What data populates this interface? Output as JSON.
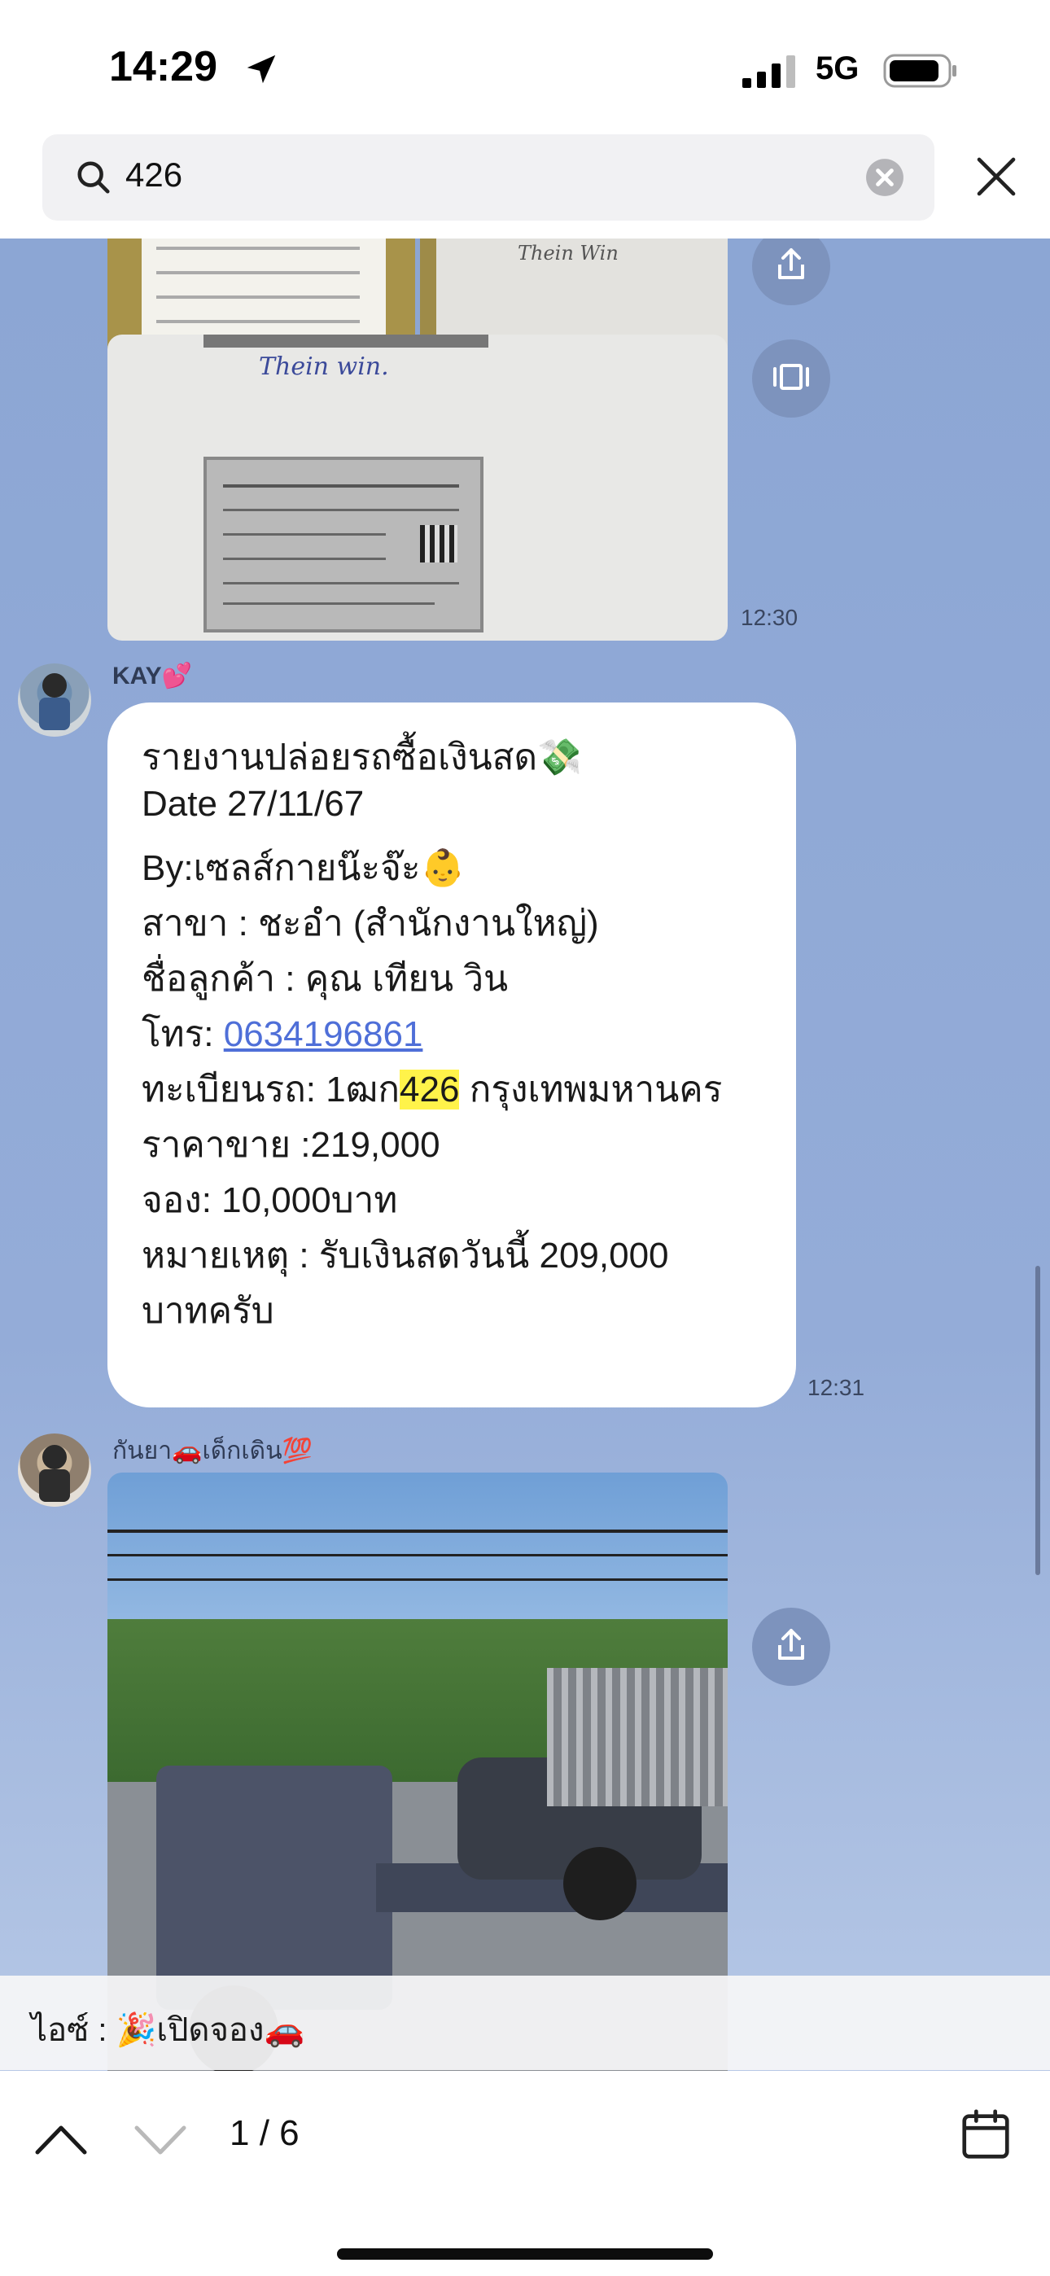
{
  "status_bar": {
    "time": "14:29",
    "network": "5G"
  },
  "search": {
    "query": "426"
  },
  "messages": [
    {
      "type": "images",
      "time": "12:30",
      "doc_handwriting": "Thein win.",
      "doc_handwriting_2": "Thein Win"
    },
    {
      "type": "text",
      "sender": "KAY💕",
      "time": "12:31",
      "lines": {
        "l1": "รายงานปล่อยรถซื้อเงินสด💸",
        "l2": "Date 27/11/67",
        "l3": "By:เซลส์กายน๊ะจ๊ะ👶",
        "l4": "สาขา : ชะอำ (สำนักงานใหญ่)",
        "l5": "ชื่อลูกค้า : คุณ เทียน วิน",
        "l6_label": "โทร: ",
        "l6_phone": "0634196861",
        "l7_pre": "ทะเบียนรถ: 1ฒก",
        "l7_match": "426",
        "l7_post": " กรุงเทพมหานคร",
        "l8": "ราคาขาย :219,000",
        "l9": "จอง: 10,000บาท",
        "l10": "หมายเหตุ : รับเงินสดวันนี้ 209,000",
        "l11": "บาทครับ"
      }
    },
    {
      "type": "image",
      "sender": "กันยา🚗เด็กเดิน💯"
    }
  ],
  "pinned": {
    "text": "ไอซ์ : 🎉เปิดจอง🚗"
  },
  "navigation": {
    "counter": "1 / 6"
  },
  "icons": {
    "share": "share-icon",
    "expand": "expand-icon",
    "calendar": "calendar-icon"
  }
}
